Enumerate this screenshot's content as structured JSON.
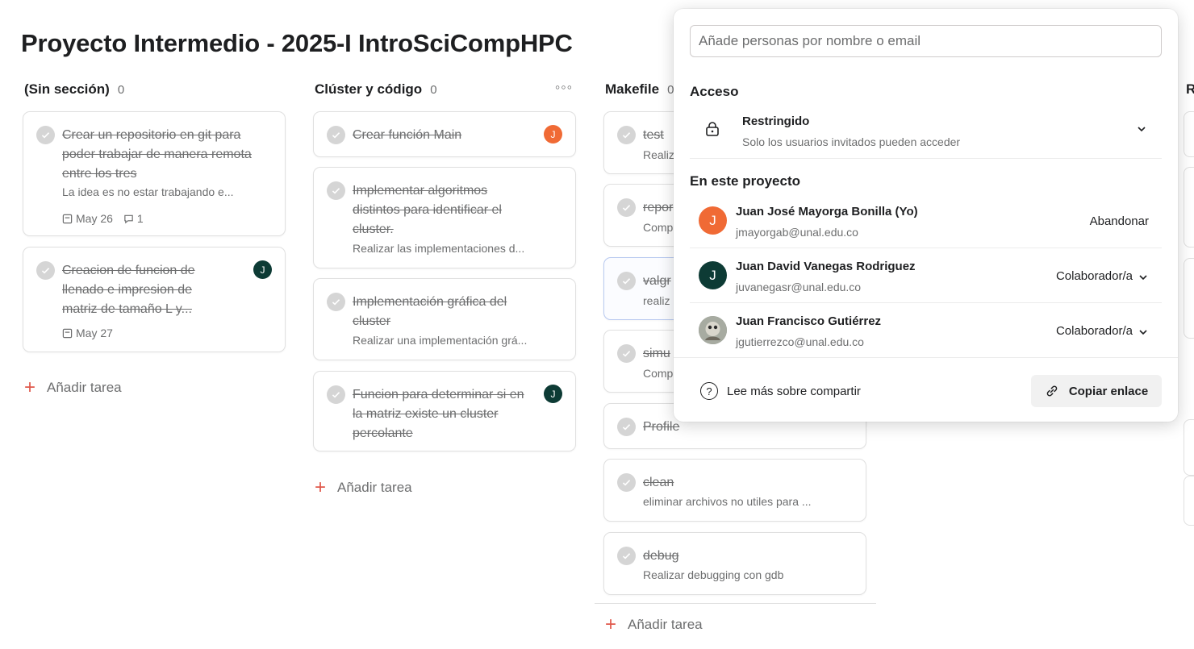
{
  "project": {
    "title": "Proyecto Intermedio - 2025-I IntroSciCompHPC"
  },
  "board": {
    "add_task_label": "Añadir tarea",
    "columns": [
      {
        "title": "(Sin sección)",
        "count": "0",
        "tasks": [
          {
            "title": "Crear un repositorio en git para poder trabajar de manera remota entre los tres",
            "desc": "La idea es no estar trabajando e...",
            "date": "May 26",
            "comments": "1"
          },
          {
            "title": "Creacion de funcion de llenado e impresion de matriz de tamaño L y...",
            "date": "May 27",
            "avatar": "J"
          }
        ]
      },
      {
        "title": "Clúster y código",
        "count": "0",
        "more": "◦◦◦",
        "tasks": [
          {
            "title": "Crear función Main",
            "avatar": "J"
          },
          {
            "title": "Implementar algoritmos distintos para identificar el cluster.",
            "desc": "Realizar las implementaciones d..."
          },
          {
            "title": "Implementación gráfica del cluster",
            "desc": "Realizar una implementación grá..."
          },
          {
            "title": "Funcion para determinar si en la matriz existe un cluster percolante",
            "avatar": "J"
          }
        ]
      },
      {
        "title": "Makefile",
        "count": "0",
        "tasks": [
          {
            "title": "test",
            "desc": "Realiz"
          },
          {
            "title": "repor",
            "desc": "Comp"
          },
          {
            "title": "valgr",
            "desc": "realiz"
          },
          {
            "title": "simu",
            "desc": "Comp"
          },
          {
            "title": "Profile"
          },
          {
            "title": "clean",
            "desc": "eliminar archivos no utiles para ..."
          },
          {
            "title": "debug",
            "desc": "Realizar debugging con gdb"
          }
        ]
      },
      {
        "title": "R"
      }
    ]
  },
  "share": {
    "search_placeholder": "Añade personas por nombre o email",
    "access_heading": "Acceso",
    "access": {
      "title": "Restringido",
      "subtitle": "Solo los usuarios invitados pueden acceder"
    },
    "members_heading": "En este proyecto",
    "members": [
      {
        "initial": "J",
        "name": "Juan José Mayorga Bonilla (Yo)",
        "email": "jmayorgab@unal.edu.co",
        "role": "Abandonar"
      },
      {
        "initial": "J",
        "name": "Juan David Vanegas Rodriguez",
        "email": "juvanegasr@unal.edu.co",
        "role": "Colaborador/a"
      },
      {
        "initial": "",
        "name": "Juan Francisco Gutiérrez",
        "email": "jgutierrezco@unal.edu.co",
        "role": "Colaborador/a"
      }
    ],
    "help_label": "Lee más sobre compartir",
    "help_icon_text": "?",
    "copy_label": "Copiar enlace"
  },
  "colors": {
    "accent_orange": "#f06a35",
    "avatar_green": "#0d3b35",
    "add_plus": "#e0584b"
  }
}
